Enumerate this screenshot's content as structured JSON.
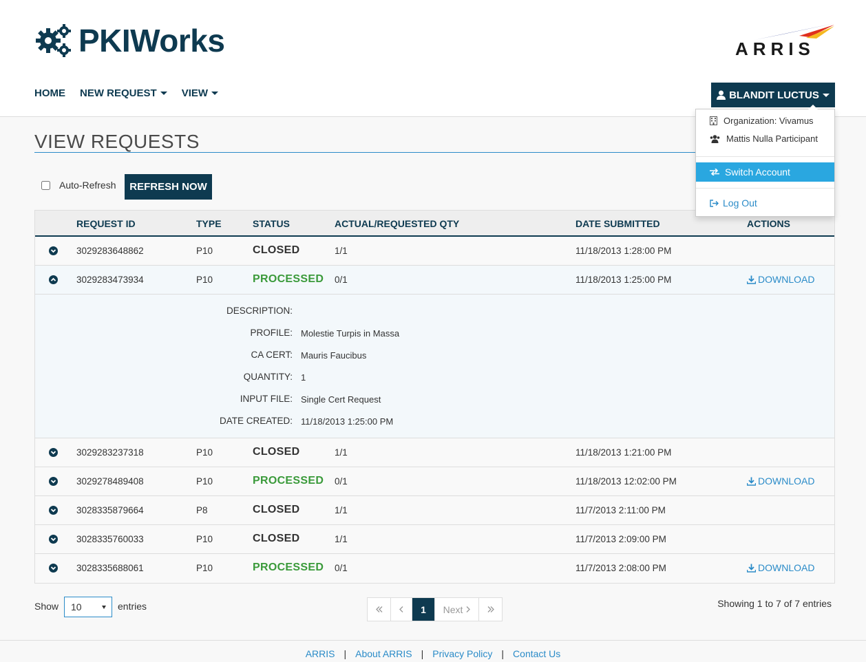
{
  "brand": {
    "app_name": "PKIWorks",
    "partner_logo": "ARRIS"
  },
  "nav": {
    "home": "HOME",
    "new_request": "NEW REQUEST",
    "view": "VIEW"
  },
  "user_menu": {
    "user_name": "BLANDIT LUCTUS",
    "organization": "Organization: Vivamus",
    "role": "Mattis Nulla Participant",
    "switch_account": "Switch Account",
    "log_out": "Log Out"
  },
  "page": {
    "title": "VIEW REQUESTS",
    "auto_refresh_label": "Auto-Refresh",
    "auto_refresh_checked": false,
    "refresh_button": "REFRESH NOW"
  },
  "table": {
    "columns": {
      "request_id": "REQUEST ID",
      "type": "TYPE",
      "status": "STATUS",
      "qty": "ACTUAL/REQUESTED QTY",
      "date": "DATE SUBMITTED",
      "actions": "ACTIONS"
    },
    "download_label": "DOWNLOAD",
    "rows": [
      {
        "id": "3029283648862",
        "type": "P10",
        "status": "CLOSED",
        "qty": "1/1",
        "date": "11/18/2013 1:28:00 PM",
        "action": ""
      },
      {
        "id": "3029283473934",
        "type": "P10",
        "status": "PROCESSED",
        "qty": "0/1",
        "date": "11/18/2013 1:25:00 PM",
        "action": "DOWNLOAD"
      },
      {
        "id": "3029283237318",
        "type": "P10",
        "status": "CLOSED",
        "qty": "1/1",
        "date": "11/18/2013 1:21:00 PM",
        "action": ""
      },
      {
        "id": "3029278489408",
        "type": "P10",
        "status": "PROCESSED",
        "qty": "0/1",
        "date": "11/18/2013 12:02:00 PM",
        "action": "DOWNLOAD"
      },
      {
        "id": "3028335879664",
        "type": "P8",
        "status": "CLOSED",
        "qty": "1/1",
        "date": "11/7/2013 2:11:00 PM",
        "action": ""
      },
      {
        "id": "3028335760033",
        "type": "P10",
        "status": "CLOSED",
        "qty": "1/1",
        "date": "11/7/2013 2:09:00 PM",
        "action": ""
      },
      {
        "id": "3028335688061",
        "type": "P10",
        "status": "PROCESSED",
        "qty": "0/1",
        "date": "11/7/2013 2:08:00 PM",
        "action": "DOWNLOAD"
      }
    ],
    "details": {
      "description_label": "DESCRIPTION:",
      "description_value": "",
      "profile_label": "PROFILE:",
      "profile_value": "Molestie Turpis in Massa",
      "ca_cert_label": "CA CERT:",
      "ca_cert_value": "Mauris Faucibus",
      "quantity_label": "QUANTITY:",
      "quantity_value": "1",
      "input_file_label": "INPUT FILE:",
      "input_file_value": "Single Cert Request",
      "date_created_label": "DATE CREATED:",
      "date_created_value": "11/18/2013 1:25:00 PM"
    }
  },
  "pagination": {
    "show_label": "Show",
    "page_size": "10",
    "entries_label": "entries",
    "current_page": "1",
    "next_label": "Next",
    "summary": "Showing 1 to 7 of 7 entries"
  },
  "footer": {
    "links": [
      "ARRIS",
      "About ARRIS",
      "Privacy Policy",
      "Contact Us"
    ]
  },
  "colors": {
    "primary": "#0e3a50",
    "link": "#2a8bc8",
    "processed": "#3a9a3a",
    "highlight": "#2aa7e0"
  }
}
